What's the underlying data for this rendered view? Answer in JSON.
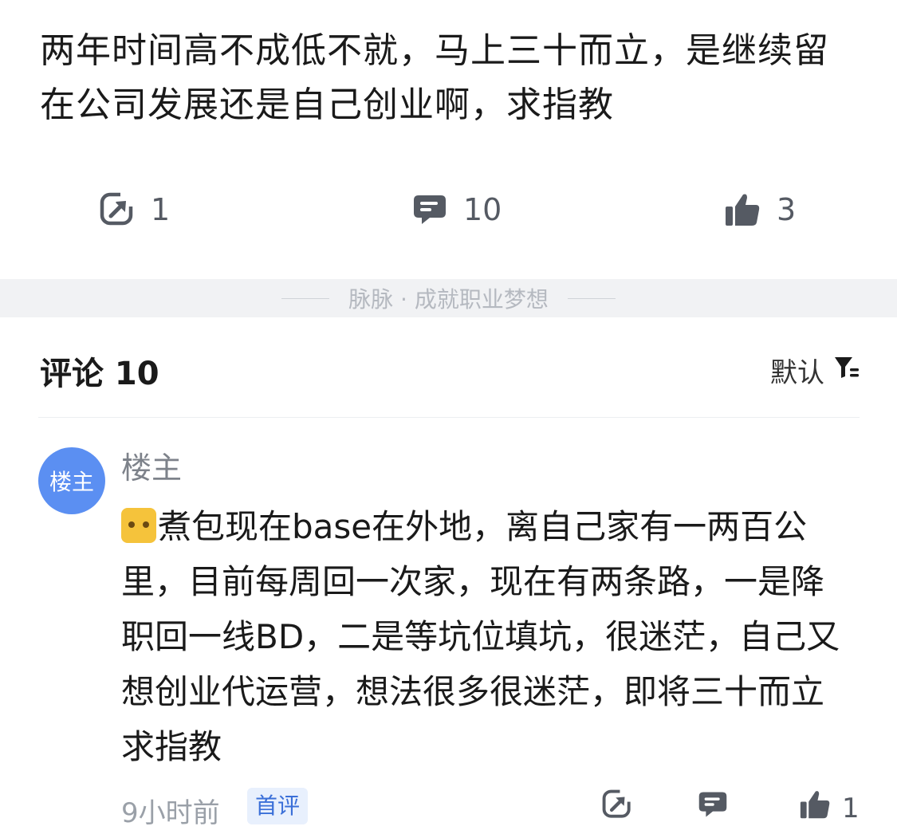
{
  "post": {
    "text": "两年时间高不成低不就，马上三十而立，是继续留在公司发展还是自己创业啊，求指教"
  },
  "actions": {
    "share_count": "1",
    "comment_count": "10",
    "like_count": "3"
  },
  "slogan": "脉脉 · 成就职业梦想",
  "comments": {
    "title": "评论 10",
    "sort_label": "默认",
    "items": [
      {
        "avatar_text": "楼主",
        "author": "楼主",
        "emoji": "sweat-smile-emoji",
        "text": "煮包现在base在外地，离自己家有一两百公里，目前每周回一次家，现在有两条路，一是降职回一线BD，二是等坑位填坑，很迷茫，自己又想创业代运营，想法很多很迷茫，即将三十而立求指教",
        "time": "9小时前",
        "badge": "首评",
        "like_count": "1"
      }
    ]
  },
  "colors": {
    "avatar_bg": "#5b8ff2",
    "badge_text": "#3a6fd8",
    "badge_bg": "#e8f0fd",
    "icon_gray": "#555a63"
  }
}
